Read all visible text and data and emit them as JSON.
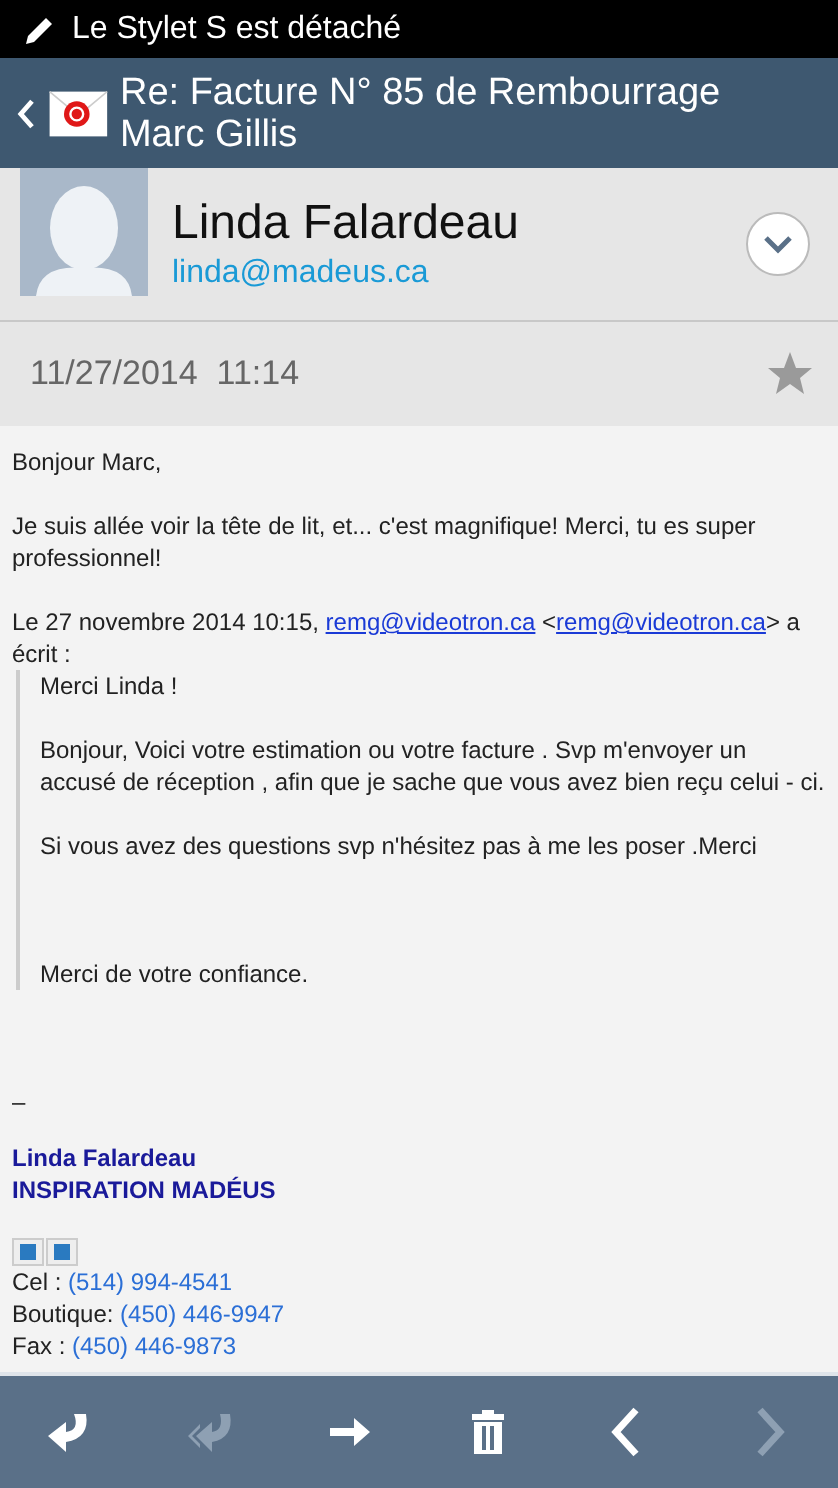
{
  "status_bar": {
    "text": "Le Stylet S est détaché"
  },
  "header": {
    "title": "Re: Facture N° 85 de Rembourrage Marc Gillis"
  },
  "sender": {
    "name": "Linda Falardeau",
    "email": "linda@madeus.ca",
    "expanded": false
  },
  "message": {
    "date": "11/27/2014  11:14",
    "starred": false
  },
  "body": {
    "greeting": "Bonjour Marc,",
    "paragraph": " Je suis allée voir la tête de lit, et... c'est magnifique! Merci, tu es super professionnel!",
    "quote_header": {
      "prefix": "Le 27 novembre 2014 10:15, ",
      "link_1": "remg@videotron.ca",
      "middle": " <",
      "link_2": "remg@videotron.ca",
      "suffix": "> a écrit :"
    },
    "quote": [
      "Merci Linda !",
      "Bonjour, Voici votre estimation ou votre facture . Svp m'envoyer un accusé de réception , afin que je sache que vous avez bien reçu celui - ci.",
      "Si vous avez des questions svp n'hésitez pas à me les poser .Merci",
      "Merci de votre confiance."
    ],
    "separator": "–",
    "signature": [
      "Linda Falardeau",
      "INSPIRATION MADÉUS"
    ],
    "images": [
      {
        "kind": "broken_image"
      },
      {
        "kind": "broken_image"
      }
    ],
    "contacts": [
      {
        "label": "Cel : ",
        "value": "(514) 994-4541"
      },
      {
        "label": "Boutique: ",
        "value": "(450) 446-9947"
      },
      {
        "label": "Fax : ",
        "value": "(450) 446-9873"
      }
    ]
  },
  "toolbar": [
    {
      "kind": "reply",
      "disabled": false
    },
    {
      "kind": "reply_all",
      "disabled": true
    },
    {
      "kind": "forward",
      "disabled": false
    },
    {
      "kind": "delete",
      "disabled": false
    },
    {
      "kind": "previous",
      "disabled": false
    },
    {
      "kind": "next",
      "disabled": true
    }
  ]
}
